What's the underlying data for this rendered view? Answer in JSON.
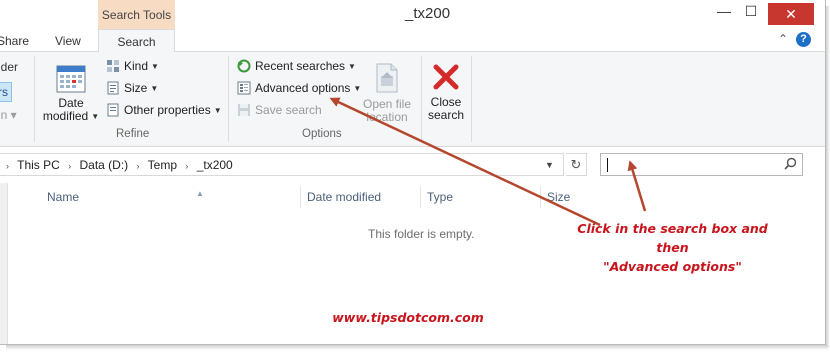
{
  "window": {
    "title": "_tx200",
    "context_tab": "Search Tools",
    "controls": {
      "minimize": "—",
      "maximize": "☐",
      "close": "✕"
    }
  },
  "ribbon_tabs": {
    "share": "Share",
    "view": "View",
    "search": "Search",
    "collapse": "⌃",
    "help": "?"
  },
  "ribbon": {
    "left_fragments": {
      "folder": "lder",
      "all": "rs",
      "in": "in ▾"
    },
    "refine": {
      "date_modified": "Date modified",
      "kind": "Kind",
      "size": "Size",
      "other_properties": "Other properties",
      "label": "Refine"
    },
    "options": {
      "recent_searches": "Recent searches",
      "advanced_options": "Advanced options",
      "save_search": "Save search",
      "open_file_location": "Open file location",
      "label": "Options"
    },
    "close_search": "Close search"
  },
  "address": {
    "crumbs": [
      "This PC",
      "Data (D:)",
      "Temp",
      "_tx200"
    ],
    "separator": "›"
  },
  "search_box": {
    "value": "",
    "icon": "search-icon"
  },
  "columns": [
    "Name",
    "Date modified",
    "Type",
    "Size"
  ],
  "empty_message": "This folder is empty.",
  "annotation": {
    "line1": "Click in the search box and then",
    "line2": "\"Advanced options\"",
    "website": "www.tipsdotcom.com",
    "color": "#c8141c",
    "arrow_color": "#b5472e"
  },
  "colors": {
    "context_tab": "#f7dcc3",
    "ribbon_bg": "#f5f6f7",
    "close_button": "#c7372f"
  }
}
